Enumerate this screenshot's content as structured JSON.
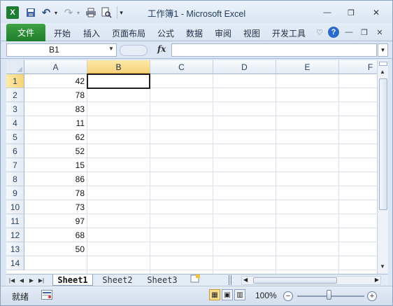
{
  "window": {
    "title": "工作簿1  -  Microsoft Excel",
    "minimize": "—",
    "restore": "❐",
    "close": "✕"
  },
  "quick_access": {
    "excel_logo": "X",
    "save": "💾",
    "undo": "↶",
    "redo": "↷",
    "print": "🖶",
    "preview": "🔍",
    "customize": "▾"
  },
  "ribbon": {
    "file_label": "文件",
    "tabs": [
      "开始",
      "插入",
      "页面布局",
      "公式",
      "数据",
      "审阅",
      "视图",
      "开发工具"
    ],
    "help": "?",
    "collapse": "♡",
    "ribbon_min": "—",
    "ribbon_restore": "❐",
    "ribbon_close": "✕"
  },
  "formula_bar": {
    "name_box": "B1",
    "fx": "fx",
    "formula": ""
  },
  "columns": [
    "A",
    "B",
    "C",
    "D",
    "E",
    "F"
  ],
  "selected_column": "B",
  "rows": [
    "1",
    "2",
    "3",
    "4",
    "5",
    "6",
    "7",
    "8",
    "9",
    "10",
    "11",
    "12",
    "13",
    "14"
  ],
  "selected_row": "1",
  "column_a_values": [
    "42",
    "78",
    "83",
    "11",
    "62",
    "52",
    "15",
    "86",
    "78",
    "73",
    "97",
    "68",
    "50",
    ""
  ],
  "sheets": {
    "tabs": [
      "Sheet1",
      "Sheet2",
      "Sheet3"
    ],
    "active": "Sheet1",
    "nav": [
      "◀◀",
      "◀",
      "▶",
      "▶▶"
    ]
  },
  "status": {
    "ready": "就绪",
    "zoom": "100%",
    "zoom_out": "−",
    "zoom_in": "+"
  }
}
